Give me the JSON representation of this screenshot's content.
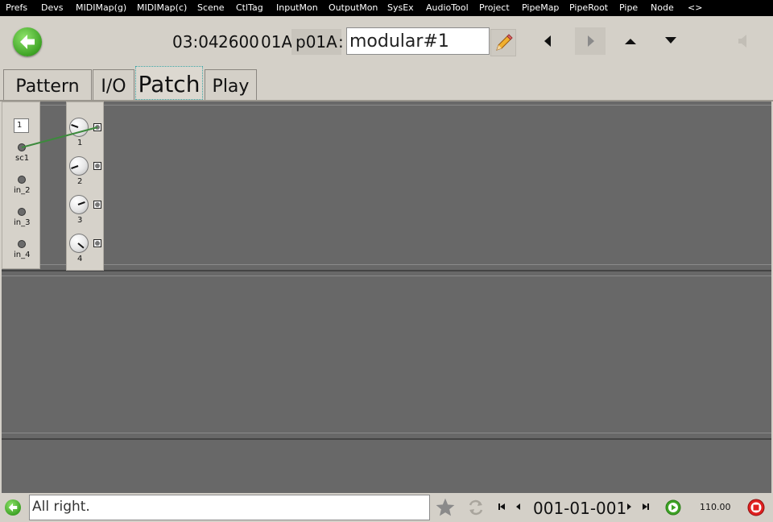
{
  "menu": [
    "Prefs",
    "Devs",
    "MIDIMap(g)",
    "MIDIMap(c)",
    "Scene",
    "CtlTag",
    "InputMon",
    "OutputMon",
    "SysEx",
    "AudioTool",
    "Project",
    "PipeMap",
    "PipeRoot",
    "Pipe",
    "Node",
    "<>"
  ],
  "header": {
    "time": "03:04",
    "number": "2600",
    "bank": "01A",
    "program": "p01A",
    "colon": ":",
    "name_value": "modular#1"
  },
  "tabs": [
    "Pattern",
    "I/O",
    "Patch",
    "Play"
  ],
  "active_tab": "Patch",
  "input_module": {
    "channel": "1",
    "ports": [
      "sc1",
      "in_2",
      "in_3",
      "in_4"
    ]
  },
  "knob_module": {
    "labels": [
      "1",
      "2",
      "3",
      "4"
    ]
  },
  "status": {
    "message": "All right.",
    "position": "001-01-001",
    "tempo": "110.00"
  },
  "colors": {
    "accent_green": "#3ea325",
    "cable_green": "#3d8a3d",
    "stop_red": "#e02020"
  },
  "icons": {
    "back": "arrow-left-icon",
    "edit": "pencil-icon",
    "prev": "triangle-left-icon",
    "next": "triangle-right-icon",
    "up": "triangle-up-icon",
    "down": "triangle-down-icon",
    "volume": "speaker-icon",
    "favorite": "star-icon",
    "sync": "refresh-icon",
    "play": "play-icon",
    "stop": "stop-icon"
  }
}
